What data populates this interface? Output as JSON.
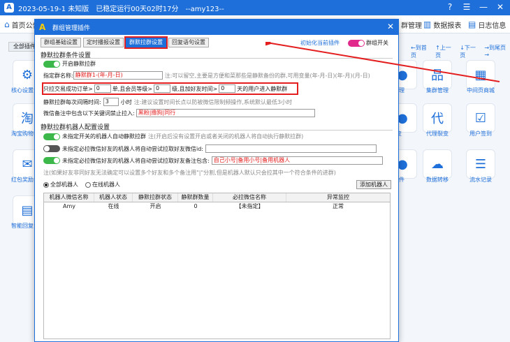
{
  "app": {
    "title": "2023-05-19-1 未知版　已稳定运行00天02时17分　--amy123--"
  },
  "toolbar": {
    "home": "首页公告",
    "group_manage": "群管理",
    "data_report": "数据报表",
    "log_info": "日志信息"
  },
  "background": {
    "all_plugins": "全部插件",
    "nav": [
      "←到首页",
      "↑上一页",
      "↓下一页",
      "→到尾页→"
    ],
    "tiles_left": [
      "核心设置",
      "淘宝购物",
      "红包奖励",
      "智能回复"
    ],
    "tiles_right": [
      {
        "label": "集群管理",
        "icon": "org-chart-icon"
      },
      {
        "label": "中间页商城",
        "icon": "store-icon"
      },
      {
        "label": "代理裂变",
        "icon": "agent-icon"
      },
      {
        "label": "用户签到",
        "icon": "calendar-check-icon"
      },
      {
        "label": "数据转移",
        "icon": "cloud-transfer-icon"
      },
      {
        "label": "流水记录",
        "icon": "list-icon"
      }
    ],
    "partial_right": [
      "管理",
      "变",
      "插件"
    ]
  },
  "dialog": {
    "title": "群组管理插件",
    "tabs": [
      "群组基础设置",
      "定时播报设置",
      "群默拉群设置",
      "回复语句设置"
    ],
    "active_tab": 2,
    "init_link": "初始化当前插件",
    "group_switch": "群组开关",
    "section1": {
      "title": "静默拉群条件设置",
      "enable_label": "开启静默拉群",
      "group_name_label": "指定群名称:",
      "group_name_value": "静默群1-(年-月-日)",
      "group_name_hint": "注:可以留空,主要是方便和菜那些是静默备份的群,可用变量(年-月-日)(年-月)(月-日)",
      "cond_prefix": "只拉交易成功订单>",
      "cond_orders": "0",
      "cond_mid1": "单,且会员等级>",
      "cond_level": "0",
      "cond_mid2": "级,且加好友时间>",
      "cond_time": "0",
      "cond_suffix": "天的用户进入静默群",
      "interval_label": "静默拉群每次间隔时间:",
      "interval_value": "3",
      "interval_unit": "小时",
      "interval_hint": "注:建议设置时间长点以防被微信限制频操作,系统默认最低3小时",
      "remark_label": "微信备注中包含以下关键词禁止拉入:",
      "remark_value": "黑粉|撸狗|同行"
    },
    "section2": {
      "title": "静默拉群机器人配置设置",
      "opt1": "未指定开关的机器人自动静默拉群",
      "opt1_hint": "注(开启后没有设置开启或者关闭的机器人将自动执行静默拉群)",
      "opt2": "未指定必拉微信好友的机器人将自动尝试拉取好友微信id:",
      "opt2_value": "",
      "opt3": "未指定必拉微信好友的机器人将自动尝试拉取好友备注包含:",
      "opt3_value": "自己小号|备用小号|备用机器人",
      "note": "注(如果好友非同好友无法确定可以设置多个好友和多个备注用\"|\"分割,但是机器人默认只会拉其中一个符合条件的进群)",
      "radio_all": "全部机器人",
      "radio_online": "在线机器人",
      "add_robot": "添加机器人"
    },
    "table": {
      "headers": [
        "机器人微信名称",
        "机器人状态",
        "静默拉群状态",
        "静默群数量",
        "必拉微信名称",
        "异常监控"
      ],
      "rows": [
        [
          "Amy",
          "在线",
          "开启",
          "0",
          "【未指定】",
          "正常"
        ]
      ]
    }
  },
  "colors": {
    "accent": "#1e6fd9",
    "highlight": "#e41e1e",
    "toggle_on": "#e0298a",
    "green": "#3cb84a"
  }
}
